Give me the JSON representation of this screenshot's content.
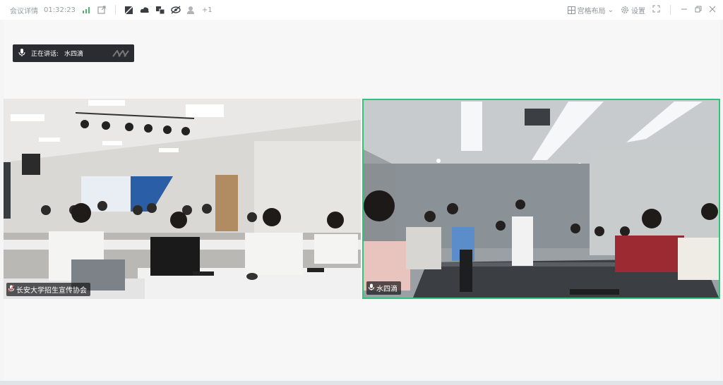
{
  "titlebar": {
    "meeting_details": "会议详情",
    "timer": "01:32:23",
    "participant_count": "+1",
    "layout_button": "宫格布局",
    "settings_button": "设置"
  },
  "speaking": {
    "prefix": "正在讲话:",
    "name": "水四滴"
  },
  "tiles": [
    {
      "label": "长安大学招生宣传协会"
    },
    {
      "label": "水四滴",
      "active": true
    }
  ],
  "colors": {
    "active_border": "#31c47a",
    "titlebar_bg": "#ffffff",
    "speaker_bar_bg": "#2a2c31"
  }
}
